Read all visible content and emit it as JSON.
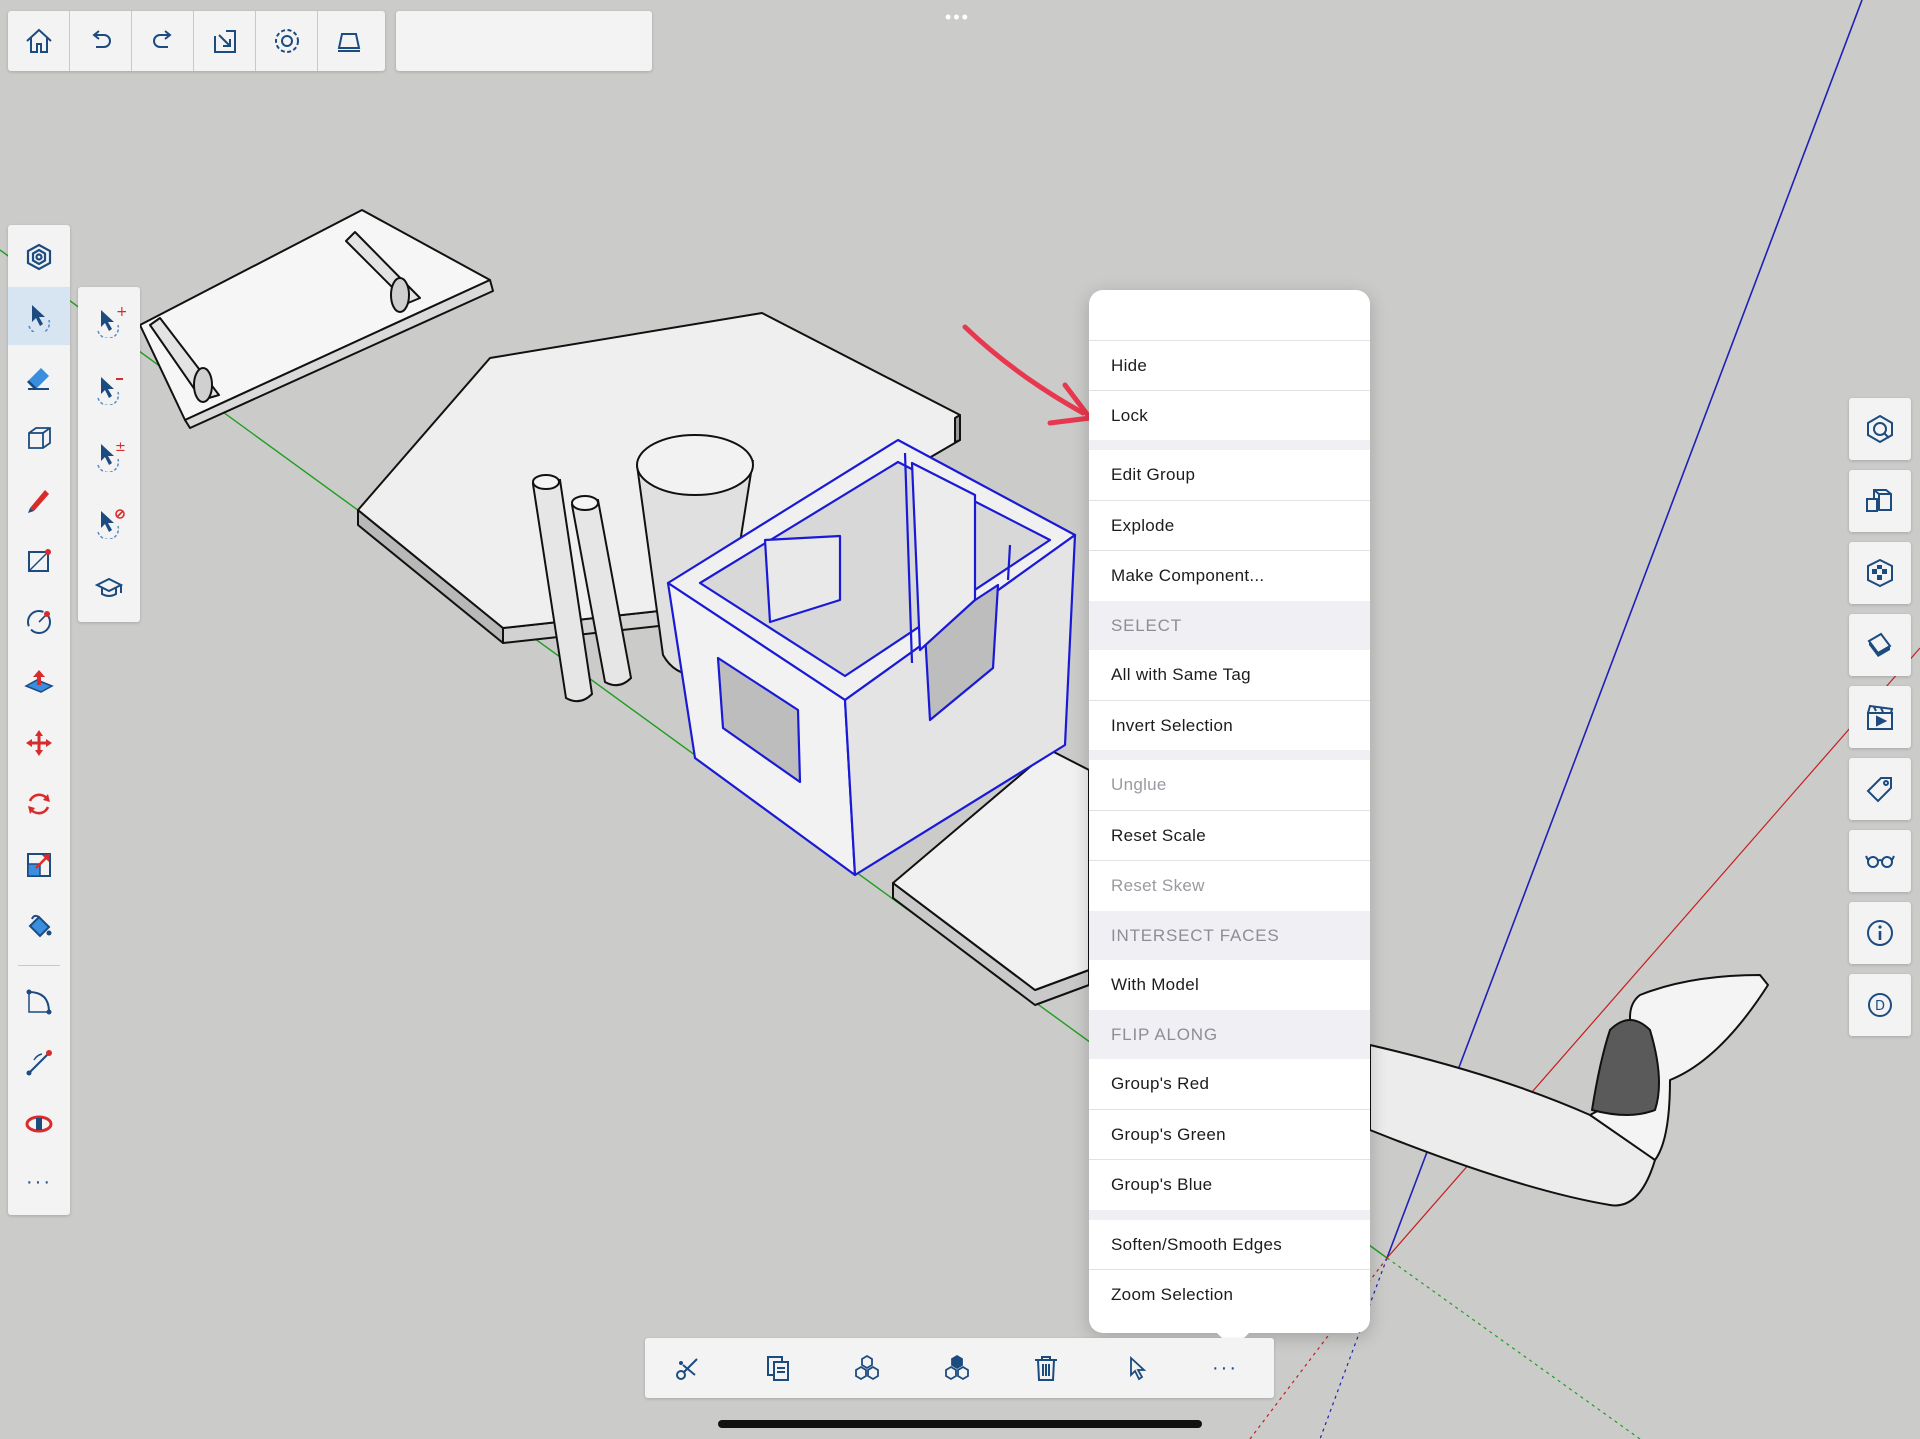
{
  "app": {
    "colors": {
      "canvas": "#cbcbc9",
      "icon_blue": "#1c4b80",
      "icon_red": "#d92b2b",
      "selection_blue": "#1a1ad6",
      "axis_green": "#1f9e1f",
      "axis_red": "#c41f1f",
      "axis_blue": "#2020b8",
      "annotation_arrow": "#e8384f"
    }
  },
  "top_toolbar": {
    "buttons": [
      "home-icon",
      "undo-icon",
      "redo-icon",
      "export-icon",
      "settings-icon",
      "display-mode-icon"
    ],
    "search": {
      "value": ""
    }
  },
  "top_dots": "•••",
  "left_toolbar": {
    "tools": [
      "search-tools-icon",
      "select-icon",
      "eraser-icon",
      "box-icon",
      "pencil-icon",
      "rectangle-icon",
      "circle-icon",
      "push-pull-icon",
      "move-icon",
      "rotate-icon",
      "scale-icon",
      "paint-bucket-icon",
      "arc-icon",
      "tape-measure-icon",
      "follow-me-icon",
      "more-icon"
    ],
    "more_label": "···"
  },
  "select_subtools": [
    "add-to-selection-icon",
    "subtract-from-selection-icon",
    "toggle-selection-icon",
    "deselect-icon",
    "instructor-icon"
  ],
  "right_panel": [
    "model-info-icon",
    "components-icon",
    "materials-icon",
    "styles-icon",
    "scenes-icon",
    "tags-icon",
    "view-options-icon",
    "entity-info-icon",
    "dimension-icon"
  ],
  "context_menu": {
    "title": "",
    "items": {
      "hide": "Hide",
      "lock": "Lock",
      "edit_group": "Edit Group",
      "explode": "Explode",
      "make_component": "Make Component...",
      "select_header": "SELECT",
      "all_same_tag": "All with Same Tag",
      "invert_selection": "Invert Selection",
      "unglue": "Unglue",
      "reset_scale": "Reset Scale",
      "reset_skew": "Reset Skew",
      "intersect_header": "INTERSECT FACES",
      "with_model": "With Model",
      "flip_header": "FLIP ALONG",
      "groups_red": "Group's Red",
      "groups_green": "Group's Green",
      "groups_blue": "Group's Blue",
      "soften_smooth": "Soften/Smooth Edges",
      "zoom_selection": "Zoom Selection"
    }
  },
  "bottom_toolbar": {
    "buttons": [
      "cut-icon",
      "copy-icon",
      "make-group-icon",
      "make-component-icon",
      "delete-icon",
      "select-pointer-icon",
      "more-dots-icon"
    ],
    "more_label": "···"
  }
}
